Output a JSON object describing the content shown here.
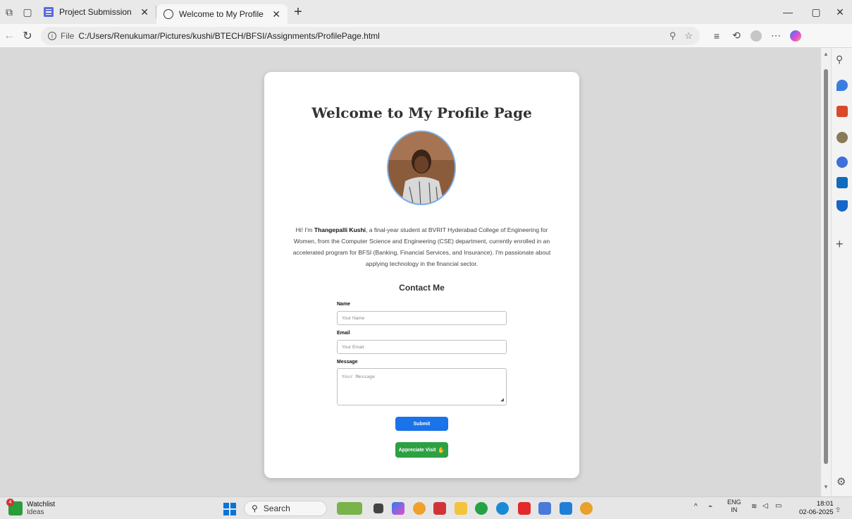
{
  "tabs": [
    {
      "title": "Project Submission Form (HTML, ",
      "active": false
    },
    {
      "title": "Welcome to My Profile",
      "active": true
    }
  ],
  "address": {
    "scheme": "File",
    "url": "C:/Users/Renukumar/Pictures/kushi/BTECH/BFSI/Assignments/ProfilePage.html"
  },
  "page": {
    "title": "Welcome to My Profile Page",
    "bio_intro": "Hi! I'm ",
    "bio_name": "Thangepalli Kushi",
    "bio_rest": ", a final-year student at BVRIT Hyderabad College of Engineering for Women, from the Computer Science and Engineering (CSE) department, currently enrolled in an accelerated program for BFSI (Banking, Financial Services, and Insurance). I'm passionate about applying technology in the financial sector.",
    "contact_title": "Contact Me",
    "form": {
      "name_label": "Name",
      "name_placeholder": "Your Name",
      "email_label": "Email",
      "email_placeholder": "Your Email",
      "message_label": "Message",
      "message_placeholder": "Your Message",
      "submit_label": "Submit",
      "appreciate_label": "Appreciate Visit"
    }
  },
  "taskbar": {
    "widget_title": "Watchlist",
    "widget_subtitle": "Ideas",
    "widget_badge": "4",
    "search_label": "Search",
    "lang": "ENG",
    "region": "IN",
    "time": "18:01",
    "date": "02-06-2025"
  },
  "colors": {
    "primary_button": "#1a73e8",
    "appreciate_button": "#2ea044"
  }
}
